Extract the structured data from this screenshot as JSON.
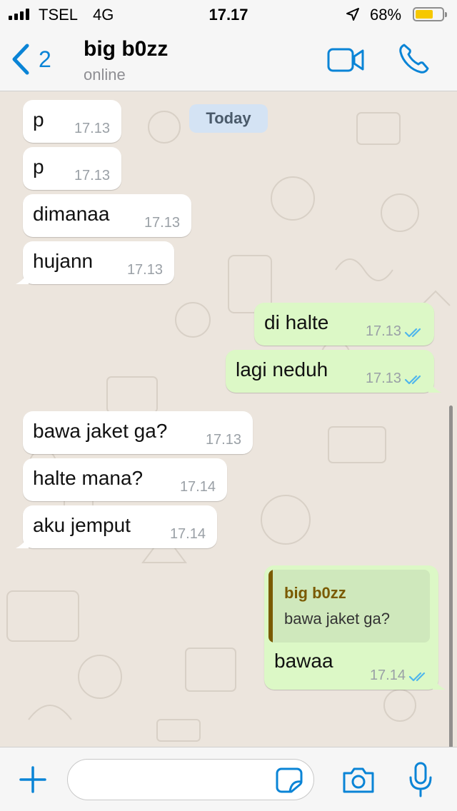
{
  "status_bar": {
    "carrier": "TSEL",
    "network": "4G",
    "time": "17.17",
    "battery_percent": "68%",
    "battery_level": 0.68
  },
  "header": {
    "back_count": "2",
    "contact_name": "big b0zz",
    "contact_status": "online",
    "icons": [
      "back-chevron-icon",
      "video-camera-icon",
      "phone-icon"
    ]
  },
  "chat": {
    "date_label": "Today",
    "messages": [
      {
        "direction": "incoming",
        "text": "p",
        "time": "17.13"
      },
      {
        "direction": "incoming",
        "text": "p",
        "time": "17.13"
      },
      {
        "direction": "incoming",
        "text": "dimanaa",
        "time": "17.13"
      },
      {
        "direction": "incoming",
        "text": "hujann",
        "time": "17.13"
      },
      {
        "direction": "outgoing",
        "text": "di halte",
        "time": "17.13",
        "status": "read"
      },
      {
        "direction": "outgoing",
        "text": "lagi neduh",
        "time": "17.13",
        "status": "read"
      },
      {
        "direction": "incoming",
        "text": "bawa jaket ga?",
        "time": "17.13"
      },
      {
        "direction": "incoming",
        "text": "halte mana?",
        "time": "17.14"
      },
      {
        "direction": "incoming",
        "text": "aku jemput",
        "time": "17.14"
      }
    ],
    "reply": {
      "quoted_author": "big b0zz",
      "quoted_text": "bawa jaket ga?",
      "text": "bawaa",
      "time": "17.14",
      "status": "read"
    }
  },
  "input_bar": {
    "value": "",
    "placeholder": "",
    "icons": [
      "plus-icon",
      "sticker-icon",
      "camera-icon",
      "microphone-icon"
    ]
  },
  "colors": {
    "accent": "#0a84d6",
    "outgoing_bubble": "#dcf8c6",
    "incoming_bubble": "#ffffff",
    "chat_background": "#ece5dd",
    "read_ticks": "#4fb6ec",
    "quote_author": "#7a5a00"
  }
}
